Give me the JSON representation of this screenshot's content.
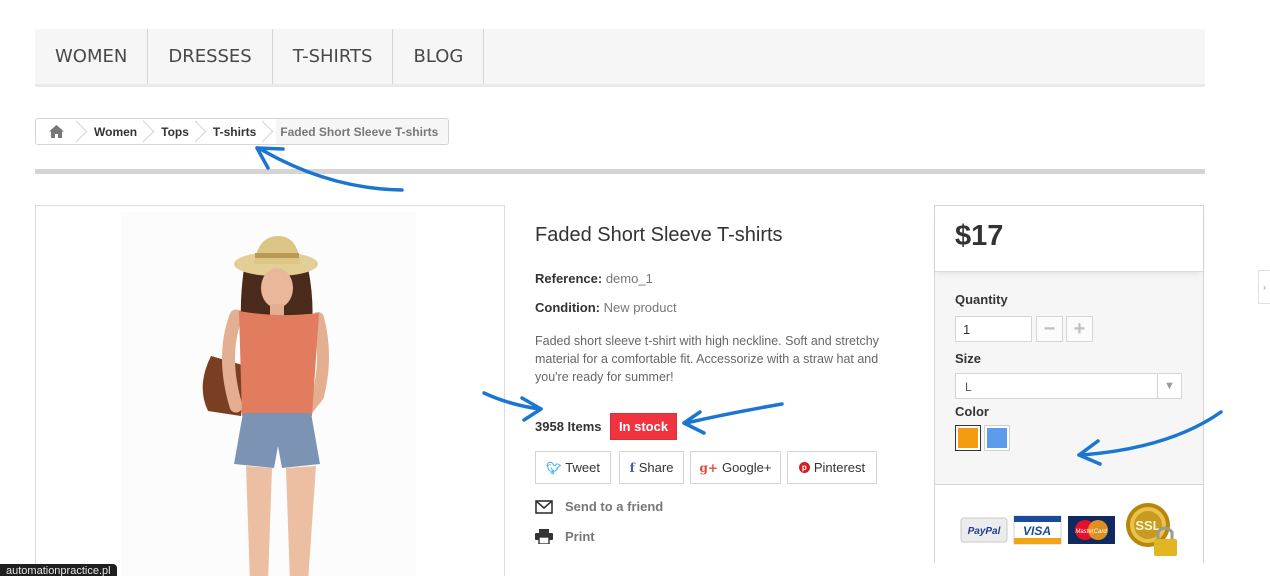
{
  "menu": {
    "items": [
      {
        "label": "Women"
      },
      {
        "label": "Dresses"
      },
      {
        "label": "T-shirts"
      },
      {
        "label": "Blog"
      }
    ]
  },
  "breadcrumb": {
    "home_icon": "home-icon",
    "items": [
      "Women",
      "Tops",
      "T-shirts"
    ],
    "current": "Faded Short Sleeve T-shirts"
  },
  "product": {
    "title": "Faded Short Sleeve T-shirts",
    "reference_label": "Reference:",
    "reference_value": "demo_1",
    "condition_label": "Condition:",
    "condition_value": "New product",
    "description": "Faded short sleeve t-shirt with high neckline. Soft and stretchy material for a comfortable fit. Accessorize with a straw hat and you're ready for summer!",
    "quantity_text": "3958 Items",
    "stock_badge": "In stock",
    "stock_color": "#f13340"
  },
  "social": [
    {
      "icon": "t",
      "label": "Tweet",
      "color": "#3fb0e9"
    },
    {
      "icon": "f",
      "label": "Share",
      "color": "#435f9f"
    },
    {
      "icon": "g+",
      "label": "Google+",
      "color": "#e04b34"
    },
    {
      "icon": "p",
      "label": "Pinterest",
      "color": "#ce1f21"
    }
  ],
  "actions": {
    "send": "Send to a friend",
    "print": "Print"
  },
  "buybox": {
    "price": "$17",
    "quantity_label": "Quantity",
    "quantity_value": "1",
    "size_label": "Size",
    "size_value": "L",
    "color_label": "Color",
    "colors": [
      "#f39c11",
      "#5d9cec"
    ],
    "payment_icons": [
      "paypal-logo",
      "visa-logo",
      "mastercard-logo",
      "ssl-badge"
    ]
  },
  "status_url": "automationpractice.pl"
}
